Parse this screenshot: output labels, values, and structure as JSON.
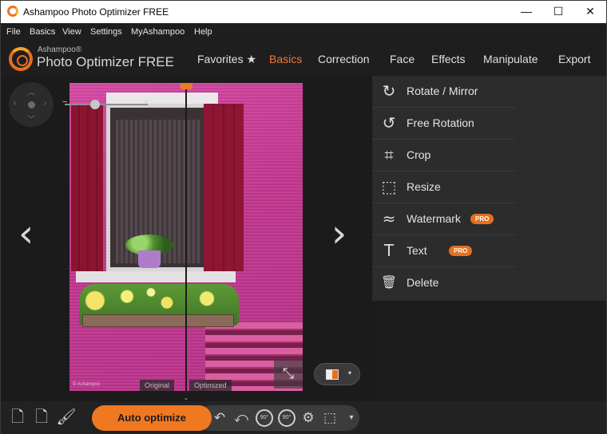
{
  "window": {
    "title": "Ashampoo Photo Optimizer FREE",
    "controls": {
      "minimize": "—",
      "maximize": "☐",
      "close": "✕"
    }
  },
  "menu": [
    "File",
    "Basics",
    "View",
    "Settings",
    "MyAshampoo",
    "Help"
  ],
  "brand": {
    "small": "Ashampoo®",
    "big": "Photo Optimizer FREE"
  },
  "nav": {
    "tabs": [
      "Favorites ★",
      "Basics",
      "Correction",
      "Face",
      "Effects",
      "Manipulate",
      "Export"
    ],
    "active": "Basics"
  },
  "viewer": {
    "zoom_minus": "−",
    "zoom_plus": "+",
    "prev_arrow": "‹",
    "next_arrow": "›",
    "label_original": "Original",
    "label_optimized": "Optimized",
    "photo_credit": "© Ashampoo",
    "fit_icon": "⤡",
    "compare_dropdown": "▾",
    "collapse": "⌄"
  },
  "tools": [
    {
      "label": "Rotate / Mirror",
      "icon": "rotate-mirror-icon",
      "glyph": "↻",
      "pro": ""
    },
    {
      "label": "Free Rotation",
      "icon": "free-rotation-icon",
      "glyph": "↺",
      "pro": ""
    },
    {
      "label": "Crop",
      "icon": "crop-icon",
      "glyph": "⌗",
      "pro": ""
    },
    {
      "label": "Resize",
      "icon": "resize-icon",
      "glyph": "⬚",
      "pro": ""
    },
    {
      "label": "Watermark",
      "icon": "watermark-icon",
      "glyph": "≈",
      "pro": "PRO"
    },
    {
      "label": "Text",
      "icon": "text-icon",
      "glyph": "T",
      "pro": "PRO"
    },
    {
      "label": "Delete",
      "icon": "delete-icon",
      "glyph": "🗑",
      "pro": ""
    }
  ],
  "bottom": {
    "new_file": "🗋",
    "add_file": "🗋",
    "clean": "🖌",
    "auto_optimize": "Auto optimize",
    "undo": "↶",
    "undo_all": "⤺",
    "rotate_left": "90°",
    "rotate_right": "90°",
    "settings": "⚙",
    "select": "⬚",
    "dropdown": "▾"
  },
  "colors": {
    "accent": "#f07820",
    "active_tab": "#f07a3a",
    "pro_badge": "#e86f1e"
  }
}
